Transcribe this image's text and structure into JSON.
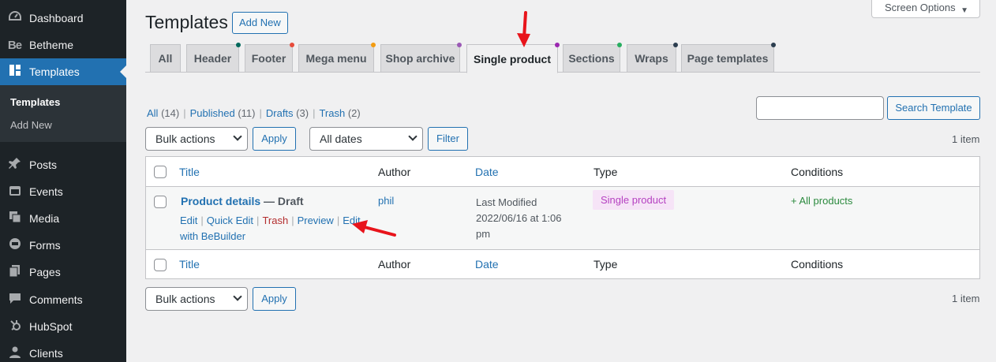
{
  "sidebar": {
    "items": [
      {
        "label": "Dashboard",
        "icon": "dashboard-icon"
      },
      {
        "label": "Betheme",
        "icon": "be-logo-icon"
      },
      {
        "label": "Templates",
        "icon": "templates-icon"
      },
      {
        "label": "Posts",
        "icon": "pin-icon"
      },
      {
        "label": "Events",
        "icon": "calendar-icon"
      },
      {
        "label": "Media",
        "icon": "media-icon"
      },
      {
        "label": "Forms",
        "icon": "forms-icon"
      },
      {
        "label": "Pages",
        "icon": "pages-icon"
      },
      {
        "label": "Comments",
        "icon": "comments-icon"
      },
      {
        "label": "HubSpot",
        "icon": "hubspot-icon"
      },
      {
        "label": "Clients",
        "icon": "clients-icon"
      }
    ],
    "be_logo_text": "Be",
    "submenu": {
      "current": "Templates",
      "other": "Add New"
    }
  },
  "header": {
    "title": "Templates",
    "add_new": "Add New",
    "screen_options": "Screen Options"
  },
  "tabs": [
    {
      "label": "All",
      "dot": ""
    },
    {
      "label": "Header",
      "dot": "#00695c"
    },
    {
      "label": "Footer",
      "dot": "#e74c3c"
    },
    {
      "label": "Mega menu",
      "dot": "#f39c12"
    },
    {
      "label": "Shop archive",
      "dot": "#9b59b6"
    },
    {
      "label": "Single product",
      "dot": "#9b27b0"
    },
    {
      "label": "Sections",
      "dot": "#27ae60"
    },
    {
      "label": "Wraps",
      "dot": "#2c3e50"
    },
    {
      "label": "Page templates",
      "dot": "#2c3e50"
    }
  ],
  "views": {
    "all": "All",
    "all_count": "(14)",
    "published": "Published",
    "published_count": "(11)",
    "drafts": "Drafts",
    "drafts_count": "(3)",
    "trash": "Trash",
    "trash_count": "(2)",
    "separator": "|"
  },
  "search": {
    "button": "Search Template",
    "value": ""
  },
  "bulk": {
    "top_select": "Bulk actions",
    "apply": "Apply",
    "dates_select": "All dates",
    "filter": "Filter",
    "item_count": "1 item",
    "bottom_select": "Bulk actions"
  },
  "table": {
    "columns": {
      "title": "Title",
      "author": "Author",
      "date": "Date",
      "type": "Type",
      "conditions": "Conditions"
    },
    "rows": [
      {
        "title": "Product details",
        "state": "— Draft",
        "author": "phil",
        "date_line1": "Last Modified",
        "date_line2": "2022/06/16 at 1:06",
        "date_line3": "pm",
        "type": "Single product",
        "condition": "+ All products",
        "actions": {
          "edit": "Edit",
          "quick_edit": "Quick Edit",
          "trash": "Trash",
          "preview": "Preview",
          "edit_bb": "Edit",
          "edit_bb_2": "with BeBuilder",
          "sep": "|"
        }
      }
    ]
  },
  "colors": {
    "accent": "#2271b1",
    "sidebar_bg": "#1d2327",
    "annotation_arrow": "#e8141b"
  }
}
